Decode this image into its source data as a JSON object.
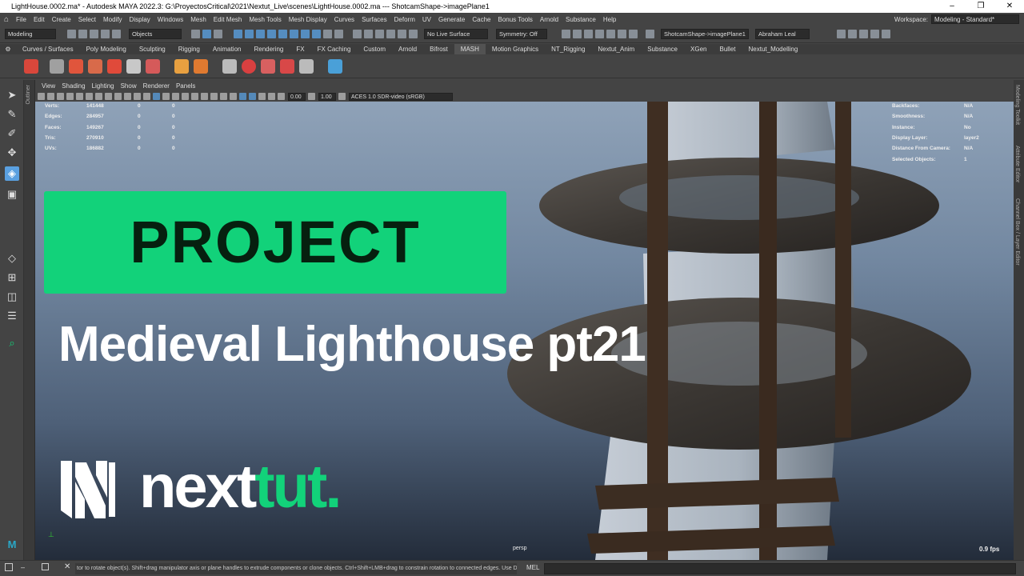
{
  "titlebar": {
    "title": "LightHouse.0002.ma* - Autodesk MAYA 2022.3: G:\\ProyectosCritical\\2021\\Nextut_Live\\scenes\\LightHouse.0002.ma   ---   ShotcamShape->imagePlane1"
  },
  "menu": [
    "File",
    "Edit",
    "Create",
    "Select",
    "Modify",
    "Display",
    "Windows",
    "Mesh",
    "Edit Mesh",
    "Mesh Tools",
    "Mesh Display",
    "Curves",
    "Surfaces",
    "Deform",
    "UV",
    "Generate",
    "Cache",
    "Bonus Tools",
    "Arnold",
    "Substance",
    "Help"
  ],
  "workspace": {
    "label": "Workspace:",
    "value": "Modeling - Standard*"
  },
  "statusline": {
    "mode": "Modeling",
    "selmode": "Objects",
    "live_surface": "No Live Surface",
    "symmetry": "Symmetry: Off",
    "camera_field": "ShotcamShape->imagePlane1",
    "user": "Abraham Leal"
  },
  "shelf_tabs": [
    "Curves / Surfaces",
    "Poly Modeling",
    "Sculpting",
    "Rigging",
    "Animation",
    "Rendering",
    "FX",
    "FX Caching",
    "Custom",
    "Arnold",
    "Bifrost",
    "MASH",
    "Motion Graphics",
    "NT_Rigging",
    "Nextut_Anim",
    "Substance",
    "XGen",
    "Bullet",
    "Nextut_Modelling"
  ],
  "shelf_active": "MASH",
  "panel_menu": [
    "View",
    "Shading",
    "Lighting",
    "Show",
    "Renderer",
    "Panels"
  ],
  "panel_tools": {
    "exposure": "0.00",
    "gamma": "1.00",
    "colorspace": "ACES 1.0 SDR-video (sRGB)"
  },
  "hud_left": [
    {
      "label": "Verts:",
      "v1": "141448",
      "v2": "0",
      "v3": "0"
    },
    {
      "label": "Edges:",
      "v1": "284957",
      "v2": "0",
      "v3": "0"
    },
    {
      "label": "Faces:",
      "v1": "149267",
      "v2": "0",
      "v3": "0"
    },
    {
      "label": "Tris:",
      "v1": "270910",
      "v2": "0",
      "v3": "0"
    },
    {
      "label": "UVs:",
      "v1": "186882",
      "v2": "0",
      "v3": "0"
    }
  ],
  "hud_right": [
    {
      "label": "Backfaces:",
      "value": "N/A"
    },
    {
      "label": "Smoothness:",
      "value": "N/A"
    },
    {
      "label": "Instance:",
      "value": "No"
    },
    {
      "label": "Display Layer:",
      "value": "layer2"
    },
    {
      "label": "Distance From Camera:",
      "value": "N/A"
    },
    {
      "label": "Selected Objects:",
      "value": "1"
    }
  ],
  "overlay": {
    "banner": "PROJECT",
    "subtitle": "Medieval Lighthouse pt21",
    "brand_main": "next",
    "brand_accent": "tut."
  },
  "viewport": {
    "camera": "persp",
    "fps": "0.9 fps"
  },
  "side_labels": {
    "outliner": "Outliner",
    "right_1": "Modeling Toolkit",
    "right_2": "Attribute Editor",
    "right_3": "Channel Box / Layer Editor"
  },
  "help_line": "tor to rotate object(s). Shift+drag manipulator axis or plane handles to extrude components or clone objects. Ctrl+Shift+LMB+drag to constrain rotation to connected edges. Use D or II",
  "command_line": {
    "language": "MEL"
  },
  "colors": {
    "accent": "#12d27a",
    "banner_text": "#06200f",
    "selection": "#5aa0e0"
  }
}
